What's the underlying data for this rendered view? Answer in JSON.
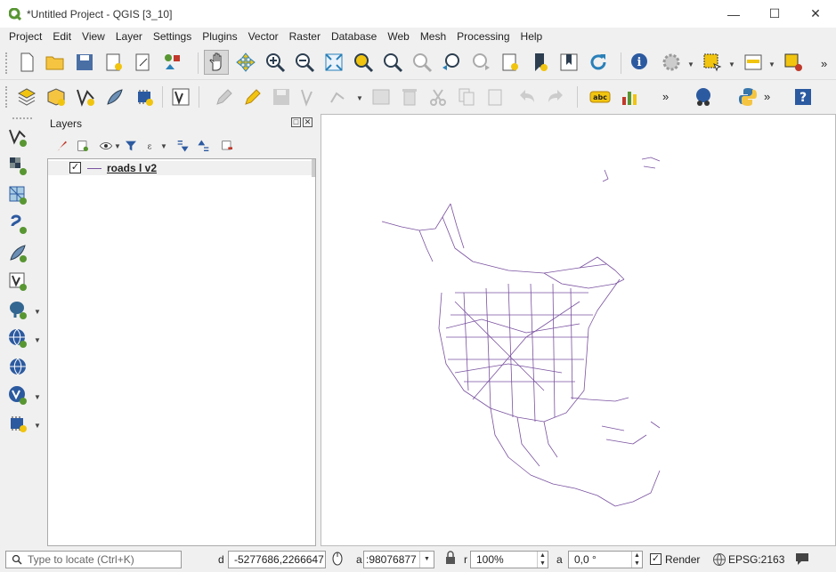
{
  "window": {
    "title": "*Untitled Project - QGIS [3_10]"
  },
  "menu": [
    "Project",
    "Edit",
    "View",
    "Layer",
    "Settings",
    "Plugins",
    "Vector",
    "Raster",
    "Database",
    "Web",
    "Mesh",
    "Processing",
    "Help"
  ],
  "toolbar_overflow": "»",
  "layers_panel": {
    "title": "Layers",
    "layers": [
      {
        "name": "roads_l_v2",
        "display": "roads l v2",
        "checked": "✓"
      }
    ]
  },
  "statusbar": {
    "locate_placeholder": "Type to locate (Ctrl+K)",
    "coordinate": "-5277686,2266647",
    "coordinate_label": "d",
    "scale_label": "a",
    "scale": ":98076877",
    "magnifier_label": "r",
    "magnifier": "100%",
    "rotation_label": "a",
    "rotation": "0,0 °",
    "render_label": "Render",
    "render_checked": "✓",
    "crs": "EPSG:2163"
  },
  "colors": {
    "road_line": "#7a52a0",
    "qgis_green": "#589632",
    "accent_yellow": "#f1c40f"
  }
}
